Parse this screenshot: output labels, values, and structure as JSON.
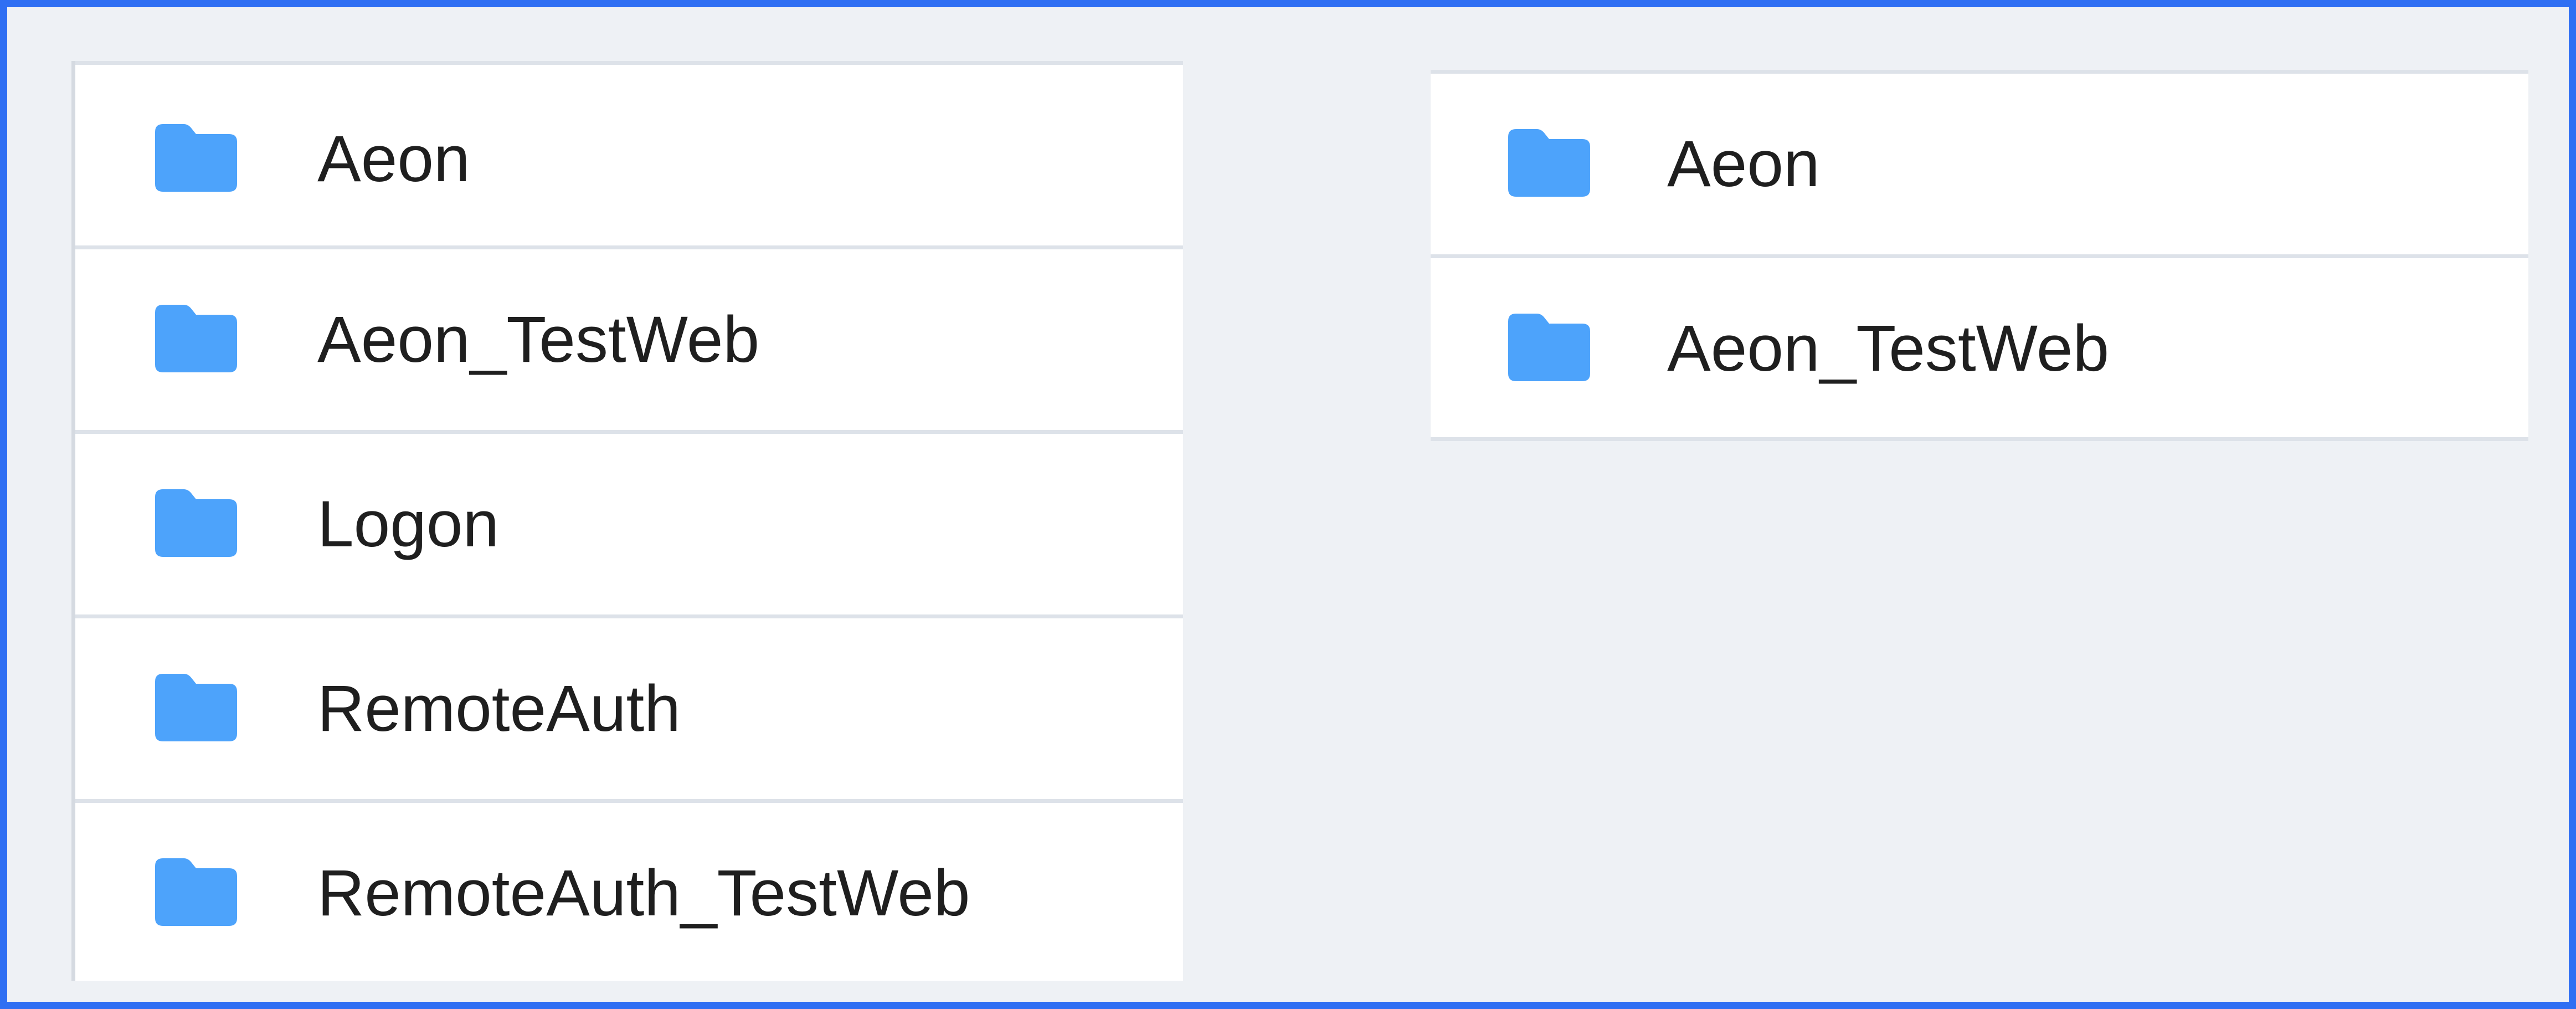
{
  "left_list": {
    "items": [
      {
        "label": "Aeon",
        "icon": "folder-icon"
      },
      {
        "label": "Aeon_TestWeb",
        "icon": "folder-icon"
      },
      {
        "label": "Logon",
        "icon": "folder-icon"
      },
      {
        "label": "RemoteAuth",
        "icon": "folder-icon"
      },
      {
        "label": "RemoteAuth_TestWeb",
        "icon": "folder-icon"
      }
    ]
  },
  "right_list": {
    "items": [
      {
        "label": "Aeon",
        "icon": "folder-icon"
      },
      {
        "label": "Aeon_TestWeb",
        "icon": "folder-icon"
      }
    ]
  },
  "colors": {
    "frame_border": "#2f6ff3",
    "background": "#eef1f5",
    "folder": "#4da3fb",
    "divider": "#dde2e9"
  }
}
